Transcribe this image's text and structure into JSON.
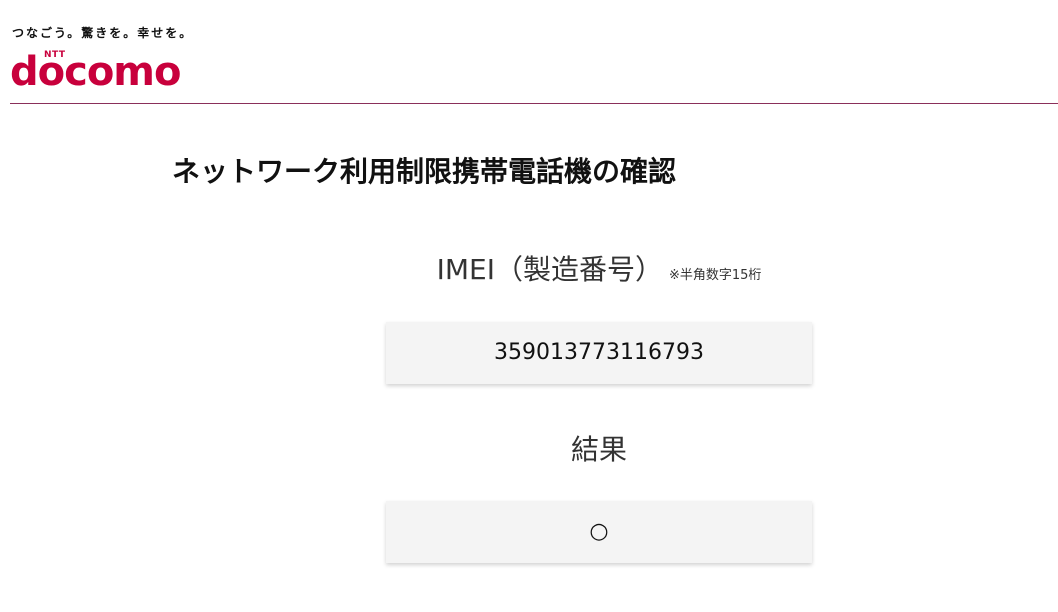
{
  "header": {
    "tagline": "つなごう。驚きを。幸せを。",
    "logo_small": "NTT",
    "logo_word": "docomo"
  },
  "page": {
    "title": "ネットワーク利用制限携帯電話機の確認"
  },
  "imei": {
    "label": "IMEI（製造番号）",
    "note": "※半角数字15桁",
    "value": "359013773116793"
  },
  "result": {
    "label": "結果",
    "value": "○"
  },
  "colors": {
    "brand": "#c8003c",
    "rule": "#8a2f5a",
    "box_bg": "#f4f4f4"
  }
}
